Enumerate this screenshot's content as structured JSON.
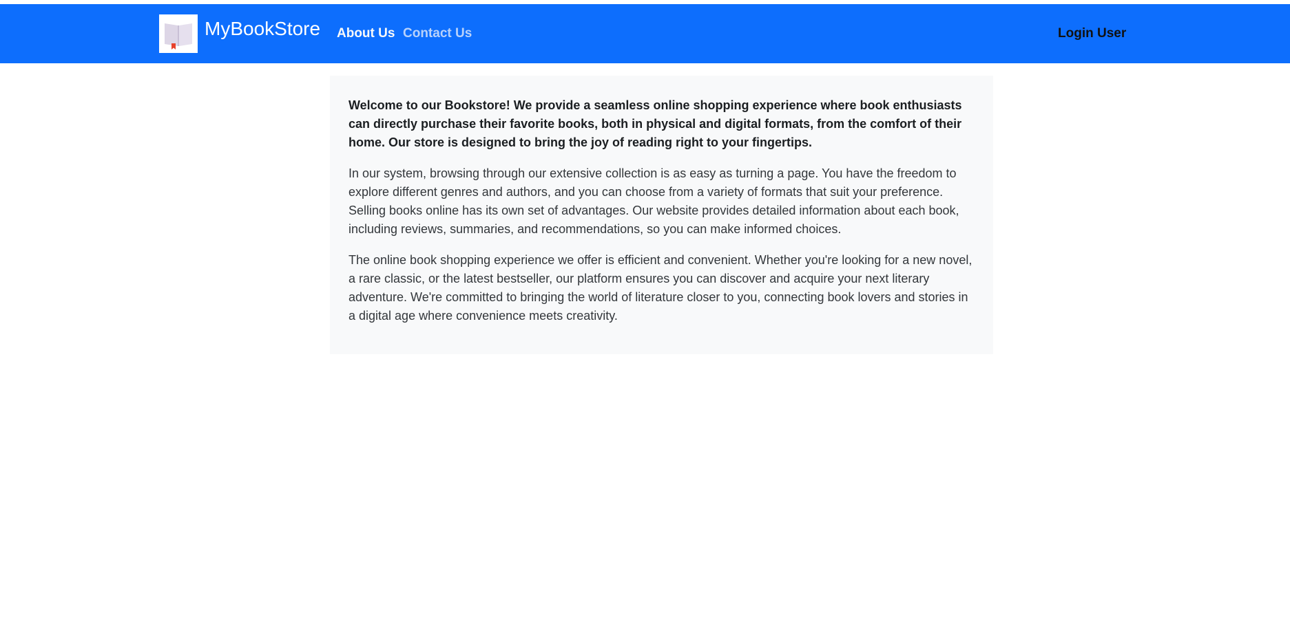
{
  "header": {
    "brand": "MyBookStore",
    "logo_icon": "book-icon",
    "nav": {
      "about": "About Us",
      "contact": "Contact Us"
    },
    "login": "Login User",
    "colors": {
      "navbar_bg": "#0d6efd",
      "card_bg": "#f8f9fa"
    }
  },
  "main": {
    "intro": "Welcome to our Bookstore! We provide a seamless online shopping experience where book enthusiasts can directly purchase their favorite books, both in physical and digital formats, from the comfort of their home. Our store is designed to bring the joy of reading right to your fingertips.",
    "paragraph_1": "In our system, browsing through our extensive collection is as easy as turning a page. You have the freedom to explore different genres and authors, and you can choose from a variety of formats that suit your preference. Selling books online has its own set of advantages. Our website provides detailed information about each book, including reviews, summaries, and recommendations, so you can make informed choices.",
    "paragraph_2": "The online book shopping experience we offer is efficient and convenient. Whether you're looking for a new novel, a rare classic, or the latest bestseller, our platform ensures you can discover and acquire your next literary adventure. We're committed to bringing the world of literature closer to you, connecting book lovers and stories in a digital age where convenience meets creativity."
  }
}
